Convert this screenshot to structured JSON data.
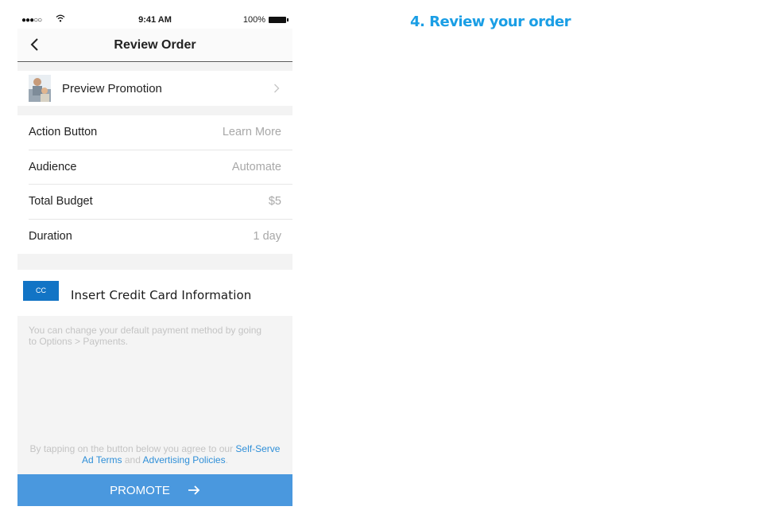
{
  "status_bar": {
    "signal": "●●●○○",
    "time": "9:41 AM",
    "battery": "100%"
  },
  "nav": {
    "title": "Review Order"
  },
  "promotion": {
    "label": "Preview Promotion"
  },
  "details": [
    {
      "key": "Action Button",
      "value": "Learn More"
    },
    {
      "key": "Audience",
      "value": "Automate"
    },
    {
      "key": "Total Budget",
      "value": "$5"
    },
    {
      "key": "Duration",
      "value": "1 day"
    }
  ],
  "credit_card": {
    "badge": "CC",
    "label": "Insert Credit Card Information"
  },
  "payment_note": "You can change your default payment method by going to Options > Payments.",
  "legal": {
    "prefix": "By tapping on the button below you agree to our ",
    "link1": "Self-Serve Ad Terms",
    "middle": " and ",
    "link2": "Advertising Policies",
    "suffix": "."
  },
  "promote_button": {
    "label": "PROMOTE"
  },
  "step_title": "4. Review your order",
  "colors": {
    "primary_button": "#4a98de",
    "cc_badge": "#1274c5",
    "step_title": "#1a9ee5",
    "link": "#2f8fd8"
  }
}
